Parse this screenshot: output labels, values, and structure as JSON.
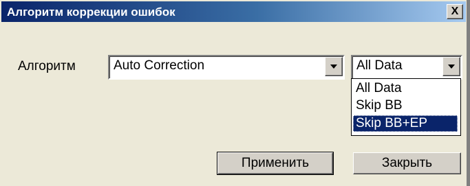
{
  "window": {
    "title": "Алгоритм коррекции ошибок",
    "close_glyph": "X"
  },
  "form": {
    "algorithm_label": "Алгоритм",
    "algorithm_value": "Auto Correction",
    "data_value": "All Data",
    "data_options": [
      "All Data",
      "Skip BB",
      "Skip BB+EP"
    ],
    "data_highlighted": "Skip BB+EP"
  },
  "buttons": {
    "apply": "Применить",
    "close": "Закрыть"
  },
  "colors": {
    "title_start": "#0a246a",
    "title_end": "#a6caf0",
    "face": "#ece9d8",
    "selection": "#0a246a"
  }
}
